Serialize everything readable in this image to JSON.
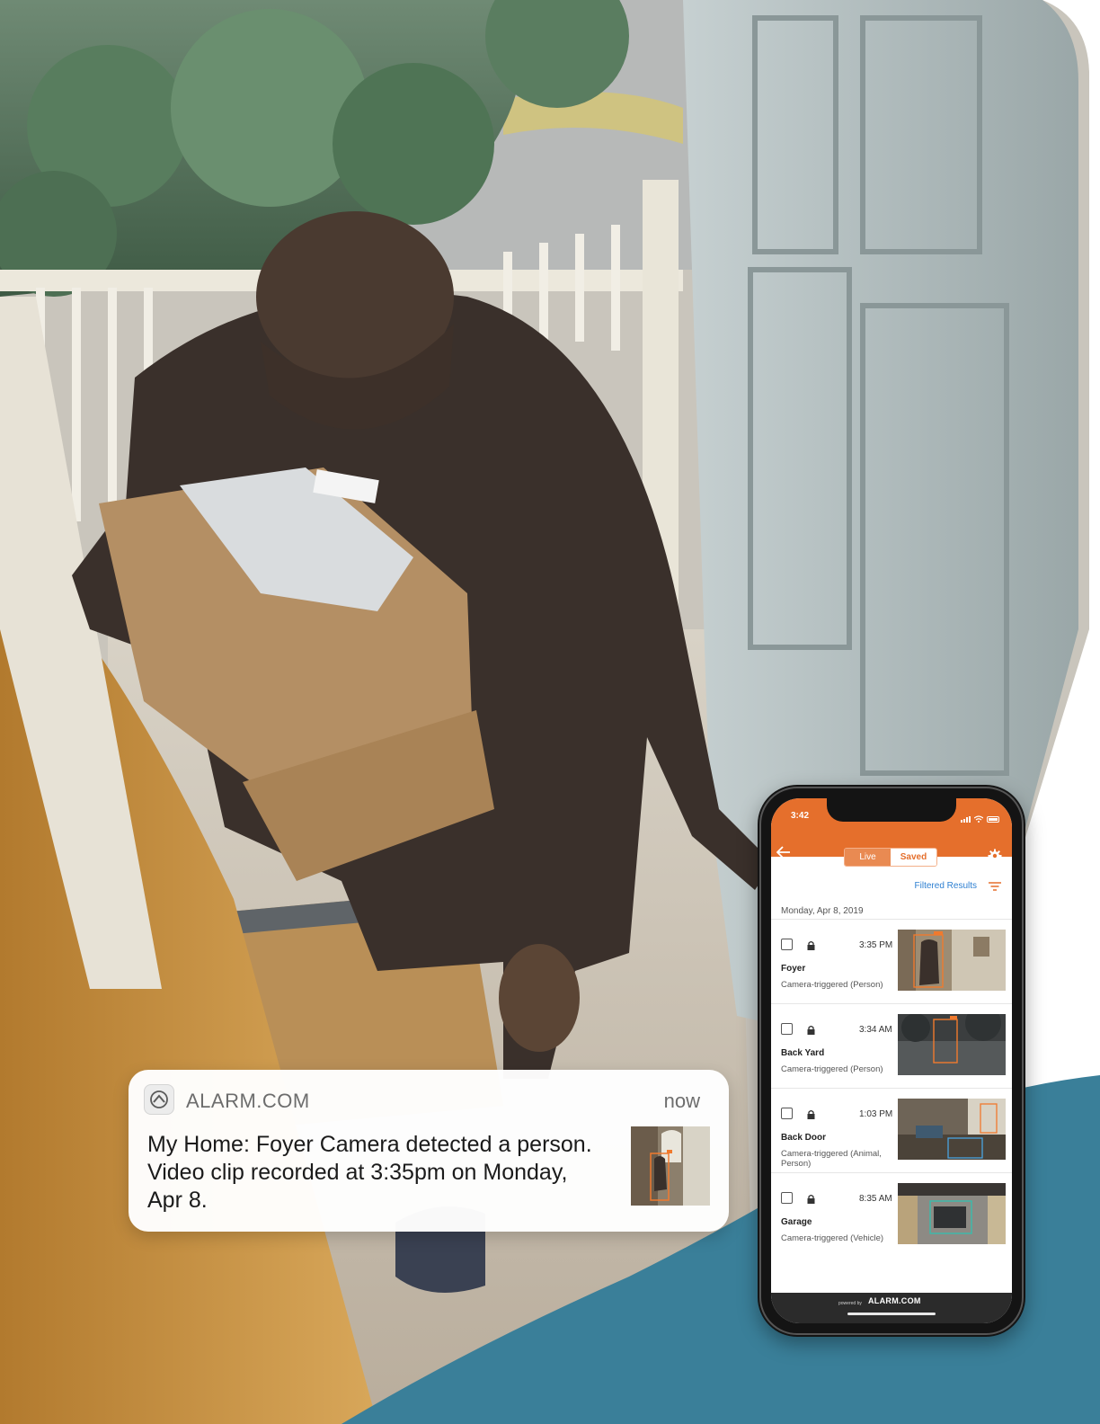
{
  "notification": {
    "app_name": "ALARM.COM",
    "time": "now",
    "message": "My Home: Foyer Camera detected a person. Video clip recorded at 3:35pm on Monday, Apr 8.",
    "app_icon": "alarm-com-logo-icon"
  },
  "phone": {
    "status_time": "3:42",
    "tabs": [
      {
        "label": "Live",
        "selected": false
      },
      {
        "label": "Saved",
        "selected": true
      }
    ],
    "filter_label": "Filtered Results",
    "date_header": "Monday, Apr 8, 2019",
    "clips": [
      {
        "time": "3:35 PM",
        "name": "Foyer",
        "description": "Camera-triggered (Person)"
      },
      {
        "time": "3:34 AM",
        "name": "Back Yard",
        "description": "Camera-triggered (Person)"
      },
      {
        "time": "1:03 PM",
        "name": "Back Door",
        "description": "Camera-triggered (Animal, Person)"
      },
      {
        "time": "8:35 AM",
        "name": "Garage",
        "description": "Camera-triggered (Vehicle)"
      }
    ],
    "footer_prefix": "powered by",
    "footer_brand": "ALARM.COM"
  },
  "colors": {
    "accent": "#e56f2c",
    "link": "#2d7fd1",
    "teal": "#3a7f99"
  },
  "icons": [
    "back-arrow-icon",
    "gear-icon",
    "filter-icon",
    "checkbox-icon",
    "lock-icon",
    "wifi-icon",
    "battery-icon",
    "signal-icon"
  ]
}
